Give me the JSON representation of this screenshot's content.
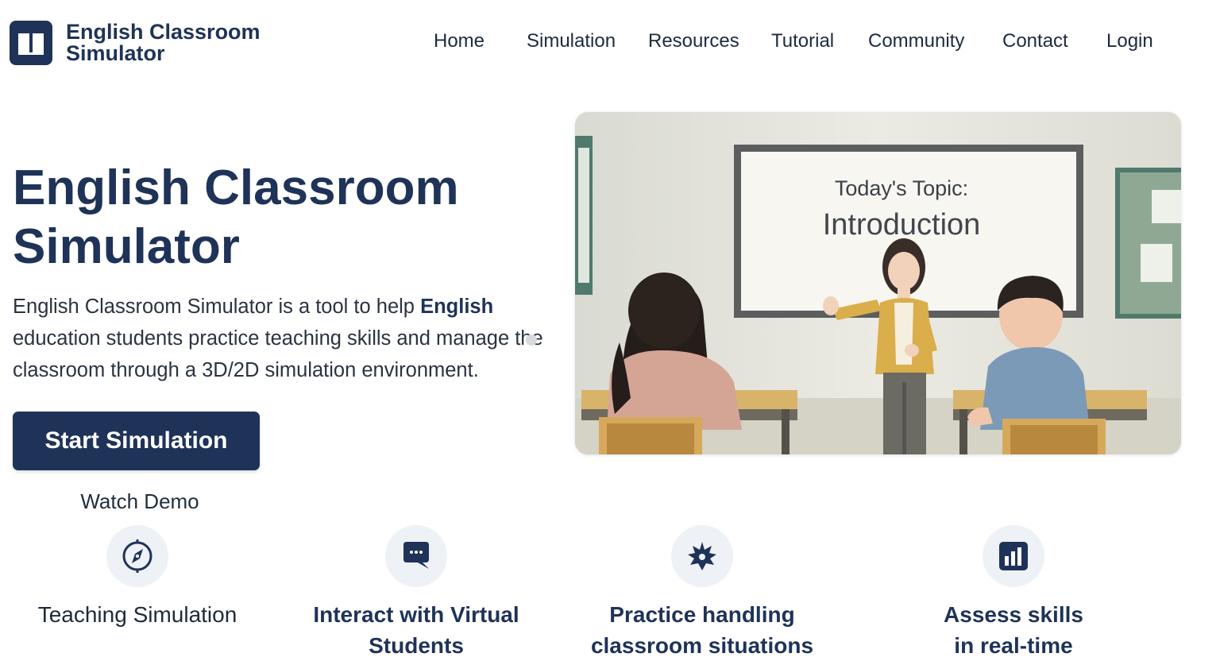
{
  "brand": {
    "name": "English Classroom Simulator",
    "logo_icon": "open-book-icon",
    "color": "#1f3358"
  },
  "nav": {
    "items": [
      {
        "label": "Home"
      },
      {
        "label": "Simulation"
      },
      {
        "label": "Resources"
      },
      {
        "label": "Tutorial"
      },
      {
        "label": "Community"
      },
      {
        "label": "Contact"
      },
      {
        "label": "Login"
      }
    ]
  },
  "hero": {
    "title": "English Classroom Simulator",
    "description_prefix": "English Classroom Simulator is a tool to help ",
    "description_bold": "English",
    "description_suffix": " education students practice teaching skills and manage the classroom through a 3D/2D simulation environment.",
    "primary_button": "Start Simulation",
    "secondary_link": "Watch Demo"
  },
  "illustration": {
    "board_label": "Today's Topic:",
    "board_topic": "Introduction"
  },
  "features": [
    {
      "icon": "compass-icon",
      "title": "Teaching Simulation"
    },
    {
      "icon": "chat-bubble-icon",
      "title": "Interact with Virtual Students"
    },
    {
      "icon": "alert-burst-icon",
      "title": "Practice handling classroom situations"
    },
    {
      "icon": "bar-chart-icon",
      "title": "Assess skills in real-time"
    }
  ],
  "colors": {
    "primary": "#1f3358",
    "text": "#2b3340",
    "icon_bg": "#eef1f6"
  }
}
